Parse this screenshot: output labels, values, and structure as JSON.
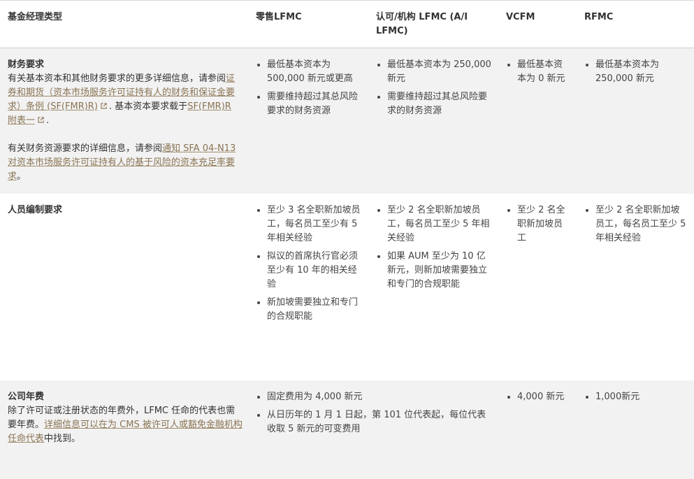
{
  "headers": [
    "基金经理类型",
    "零售LFMC",
    "认可/机构 LFMC (A/I LFMC)",
    "VCFM",
    "RFMC"
  ],
  "financial": {
    "title": "财务要求",
    "desc1_a": "有关基本资本和其他财务要求的更多详细信息，请参阅",
    "desc1_link1": "证券和期货（资本市场服务许可证持有人的财务和保证金要求）条例 (SF(FMR)R)",
    "desc1_b": ". 基本资本要求载于",
    "desc1_link2": "SF(FMR)R 附表一",
    "desc1_c": ".",
    "desc2_a": "有关财务资源要求的详细信息，请参阅",
    "desc2_link": "通知 SFA 04-N13 对资本市场服务许可证持有人的基于风险的资本充足率要求",
    "desc2_b": "。",
    "retail": [
      "最低基本资本为 500,000 新元或更高",
      "需要维持超过其总风险要求的财务资源"
    ],
    "ai": [
      "最低基本资本为 250,000 新元",
      "需要维持超过其总风险要求的财务资源"
    ],
    "vcfm": [
      "最低基本资本为 0 新元"
    ],
    "rfmc": [
      "最低基本资本为 250,000 新元"
    ]
  },
  "staffing": {
    "title": "人员编制要求",
    "retail": [
      "至少 3 名全职新加坡员工，每名员工至少有 5 年相关经验",
      "拟议的首席执行官必须至少有 10 年的相关经验",
      "新加坡需要独立和专门的合规职能"
    ],
    "ai": [
      "至少 2 名全职新加坡员工，每名员工至少 5 年相关经验",
      "如果 AUM 至少为 10 亿新元，则新加坡需要独立和专门的合规职能"
    ],
    "vcfm": [
      "至少 2 名全职新加坡员工"
    ],
    "rfmc": [
      "至少 2 名全职新加坡员工，每名员工至少 5 年相关经验"
    ]
  },
  "fees": {
    "title": "公司年费",
    "desc_a": "除了许可证或注册状态的年费外，LFMC 任命的代表也需要年费。",
    "desc_link": "详细信息可以在为 CMS 被许可人或豁免金融机构任命代表",
    "desc_b": "中找到。",
    "lfmc": [
      "固定费用为 4,000 新元",
      "从日历年的 1 月 1 日起，第 101 位代表起，每位代表收取 5 新元的可变费用"
    ],
    "vcfm": [
      "4,000 新元"
    ],
    "rfmc": [
      "1,000新元"
    ]
  }
}
